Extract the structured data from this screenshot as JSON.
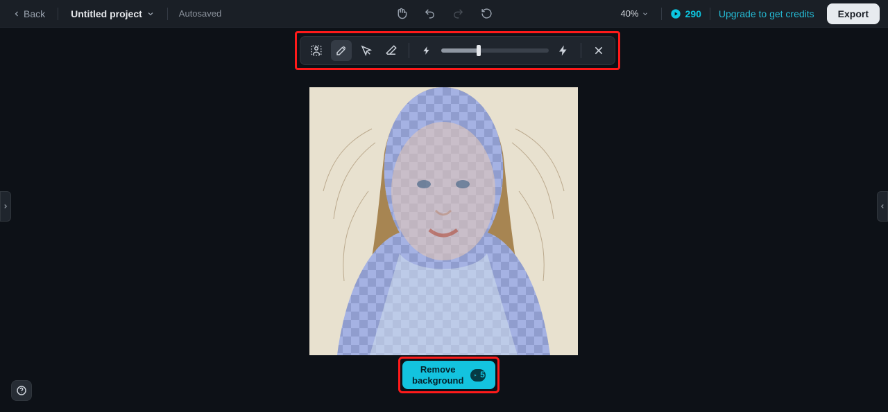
{
  "header": {
    "back_label": "Back",
    "project_name": "Untitled project",
    "autosaved_label": "Autosaved",
    "zoom": "40%",
    "credits": "290",
    "upgrade_label": "Upgrade to get credits",
    "export_label": "Export"
  },
  "toolbar": {
    "icons": {
      "select_subject": "select-subject-icon",
      "brush": "brush-icon",
      "lasso": "magic-select-icon",
      "eraser": "eraser-icon",
      "magic_left": "bolt-small-icon",
      "magic_right": "bolt-icon",
      "close": "close-icon"
    },
    "slider_percent": 35
  },
  "action": {
    "remove_bg_line1": "Remove",
    "remove_bg_line2": "background",
    "cost": "5"
  },
  "canvas": {
    "alt": "Portrait photo with background-removal selection mask"
  }
}
